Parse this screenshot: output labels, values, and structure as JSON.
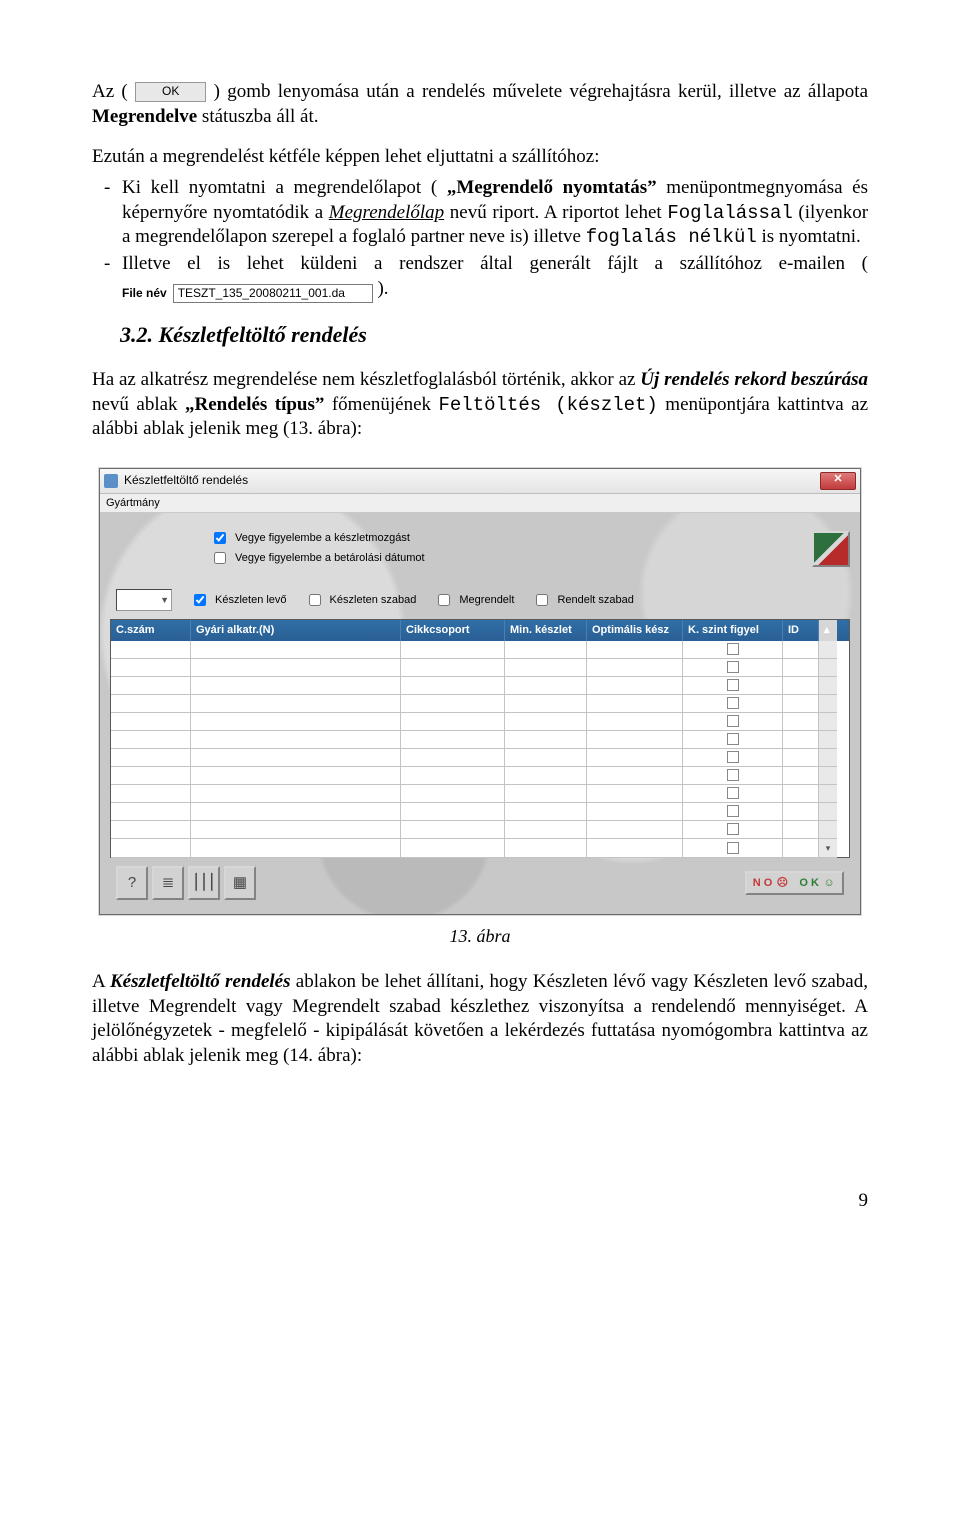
{
  "intro": {
    "t1a": "Az (",
    "ok_btn": "OK",
    "t1b": ") gomb lenyomása után a rendelés művelete végrehajtásra kerül, illetve az állapota ",
    "status_word": "Megrendelve",
    "t1c": " státuszba áll át."
  },
  "para2": {
    "lead": "Ezután a megrendelést kétféle képpen lehet eljuttatni a szállítóhoz:",
    "b1a": "Ki kell nyomtatni a megrendelőlapot (",
    "b1q1": "„Megrendelő nyomtatás”",
    "b1b": " menüpontmegnyomása és képernyőre nyomtatódik a ",
    "b1u": "Megrendelőlap",
    "b1c": " nevű riport. A riportot lehet ",
    "b1m1": "Foglalással",
    "b1d": " (ilyenkor a megrendelőlapon szerepel a foglaló partner neve is) illetve ",
    "b1m2": "foglalás nélkül",
    "b1e": " is nyomtatni.",
    "b2a": "Illetve el is lehet küldeni a rendszer által generált fájlt a szállítóhoz e-mailen (",
    "file_label": "File név",
    "file_value": "TESZT_135_20080211_001.da",
    "b2b": ")."
  },
  "section": {
    "num": "3.2.",
    "title": "Készletfeltöltő rendelés"
  },
  "para3": {
    "a": "Ha az alkatrész megrendelése nem készletfoglalásból történik, akkor az ",
    "b1": "Új rendelés rekord beszúrása",
    "b": " nevű ablak ",
    "b2": "„Rendelés típus”",
    "c": " főmenüjének ",
    "m": "Feltöltés (készlet)",
    "d": " menüpontjára kattintva az alábbi ablak jelenik meg (13. ábra):"
  },
  "window": {
    "title": "Készletfeltöltő rendelés",
    "menu": "Gyártmány",
    "opt1": "Vegye figyelembe a készletmozgást",
    "opt2": "Vegye figyelembe a betárolási dátumot",
    "f1": "Készleten levő",
    "f2": "Készleten szabad",
    "f3": "Megrendelt",
    "f4": "Rendelt szabad",
    "cols": {
      "c1": "C.szám",
      "c2": "Gyári alkatr.(N)",
      "c3": "Cikkcsoport",
      "c4": "Min. készlet",
      "c5": "Optimális kész",
      "c6": "K. szint figyel",
      "c7": "ID"
    },
    "no": "N O",
    "ok": "O K"
  },
  "caption": "13. ábra",
  "para4": {
    "a": "A ",
    "b1": "Készletfeltöltő rendelés",
    "b": " ablakon be lehet állítani, hogy Készleten lévő vagy Készleten levő szabad, illetve Megrendelt vagy Megrendelt szabad készlethez viszonyítsa a rendelendő mennyiséget. A jelölőnégyzetek - megfelelő - kipipálását követően a lekérdezés futtatása nyomógombra kattintva az alábbi ablak jelenik meg (14. ábra):"
  },
  "page_number": "9"
}
